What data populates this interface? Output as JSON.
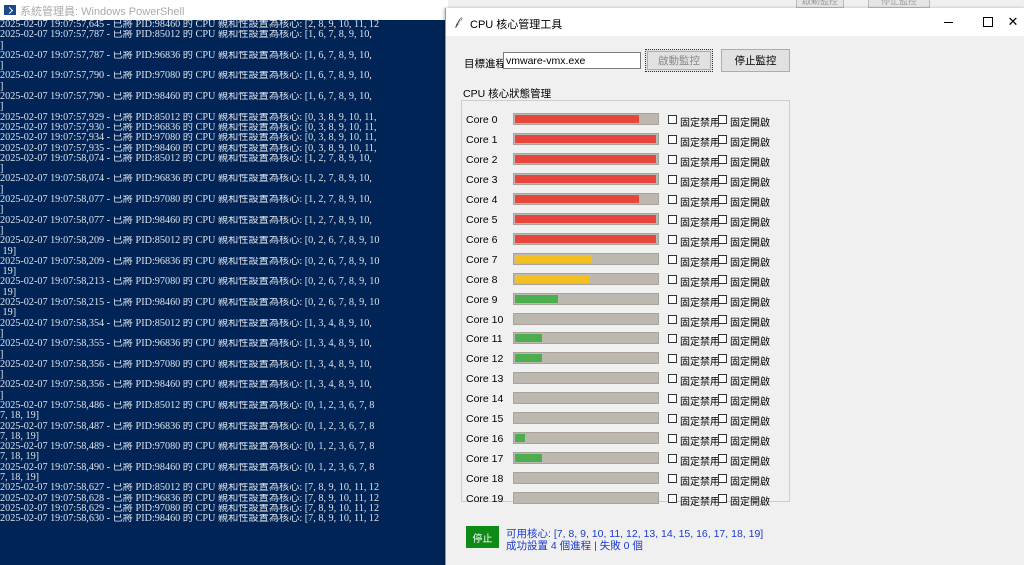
{
  "powershell": {
    "title": "系統管理員: Windows PowerShell",
    "lines": [
      "2025-02-07 19:07:57,645 - 已將 PID:98460 的 CPU 親和性設置為核心: [2, 8, 9, 10, 11, 12",
      "2025-02-07 19:07:57,787 - 已將 PID:85012 的 CPU 親和性設置為核心: [1, 6, 7, 8, 9, 10,",
      "]",
      "2025-02-07 19:07:57,787 - 已將 PID:96836 的 CPU 親和性設置為核心: [1, 6, 7, 8, 9, 10,",
      "]",
      "2025-02-07 19:07:57,790 - 已將 PID:97080 的 CPU 親和性設置為核心: [1, 6, 7, 8, 9, 10,",
      "]",
      "2025-02-07 19:07:57,790 - 已將 PID:98460 的 CPU 親和性設置為核心: [1, 6, 7, 8, 9, 10,",
      "]",
      "2025-02-07 19:07:57,929 - 已將 PID:85012 的 CPU 親和性設置為核心: [0, 3, 8, 9, 10, 11,",
      "2025-02-07 19:07:57,930 - 已將 PID:96836 的 CPU 親和性設置為核心: [0, 3, 8, 9, 10, 11,",
      "2025-02-07 19:07:57,934 - 已將 PID:97080 的 CPU 親和性設置為核心: [0, 3, 8, 9, 10, 11,",
      "2025-02-07 19:07:57,935 - 已將 PID:98460 的 CPU 親和性設置為核心: [0, 3, 8, 9, 10, 11,",
      "2025-02-07 19:07:58,074 - 已將 PID:85012 的 CPU 親和性設置為核心: [1, 2, 7, 8, 9, 10,",
      "]",
      "2025-02-07 19:07:58,074 - 已將 PID:96836 的 CPU 親和性設置為核心: [1, 2, 7, 8, 9, 10,",
      "]",
      "2025-02-07 19:07:58,077 - 已將 PID:97080 的 CPU 親和性設置為核心: [1, 2, 7, 8, 9, 10,",
      "]",
      "2025-02-07 19:07:58,077 - 已將 PID:98460 的 CPU 親和性設置為核心: [1, 2, 7, 8, 9, 10,",
      "]",
      "2025-02-07 19:07:58,209 - 已將 PID:85012 的 CPU 親和性設置為核心: [0, 2, 6, 7, 8, 9, 10",
      " 19]",
      "2025-02-07 19:07:58,209 - 已將 PID:96836 的 CPU 親和性設置為核心: [0, 2, 6, 7, 8, 9, 10",
      " 19]",
      "2025-02-07 19:07:58,213 - 已將 PID:97080 的 CPU 親和性設置為核心: [0, 2, 6, 7, 8, 9, 10",
      " 19]",
      "2025-02-07 19:07:58,215 - 已將 PID:98460 的 CPU 親和性設置為核心: [0, 2, 6, 7, 8, 9, 10",
      " 19]",
      "2025-02-07 19:07:58,354 - 已將 PID:85012 的 CPU 親和性設置為核心: [1, 3, 4, 8, 9, 10,",
      "]",
      "2025-02-07 19:07:58,355 - 已將 PID:96836 的 CPU 親和性設置為核心: [1, 3, 4, 8, 9, 10,",
      "]",
      "2025-02-07 19:07:58,356 - 已將 PID:97080 的 CPU 親和性設置為核心: [1, 3, 4, 8, 9, 10,",
      "]",
      "2025-02-07 19:07:58,356 - 已將 PID:98460 的 CPU 親和性設置為核心: [1, 3, 4, 8, 9, 10,",
      "]",
      "2025-02-07 19:07:58,486 - 已將 PID:85012 的 CPU 親和性設置為核心: [0, 1, 2, 3, 6, 7, 8",
      "7, 18, 19]",
      "2025-02-07 19:07:58,487 - 已將 PID:96836 的 CPU 親和性設置為核心: [0, 1, 2, 3, 6, 7, 8",
      "7, 18, 19]",
      "2025-02-07 19:07:58,489 - 已將 PID:97080 的 CPU 親和性設置為核心: [0, 1, 2, 3, 6, 7, 8",
      "7, 18, 19]",
      "2025-02-07 19:07:58,490 - 已將 PID:98460 的 CPU 親和性設置為核心: [0, 1, 2, 3, 6, 7, 8",
      "7, 18, 19]",
      "2025-02-07 19:07:58,627 - 已將 PID:85012 的 CPU 親和性設置為核心: [7, 8, 9, 10, 11, 12",
      "2025-02-07 19:07:58,628 - 已將 PID:96836 的 CPU 親和性設置為核心: [7, 8, 9, 10, 11, 12",
      "2025-02-07 19:07:58,629 - 已將 PID:97080 的 CPU 親和性設置為核心: [7, 8, 9, 10, 11, 12",
      "2025-02-07 19:07:58,630 - 已將 PID:98460 的 CPU 親和性設置為核心: [7, 8, 9, 10, 11, 12"
    ]
  },
  "background_buttons": [
    "啟動監控",
    "停止監控"
  ],
  "app": {
    "title": "CPU 核心管理工具",
    "target_label": "目標進程:",
    "target_value": "vmware-vmx.exe",
    "start_button": "啟動監控",
    "stop_button": "停止監控",
    "group_label": "CPU 核心狀態管理",
    "lock_disable_label": "固定禁用",
    "lock_enable_label": "固定開啟",
    "colors": {
      "high": "#e8453c",
      "medium": "#f4bf22",
      "low": "#4cae4f",
      "track": "#bcb8b0"
    },
    "cores": [
      {
        "label": "Core 0",
        "load": 0.87,
        "level": "high"
      },
      {
        "label": "Core 1",
        "load": 0.99,
        "level": "high"
      },
      {
        "label": "Core 2",
        "load": 0.99,
        "level": "high"
      },
      {
        "label": "Core 3",
        "load": 0.99,
        "level": "high"
      },
      {
        "label": "Core 4",
        "load": 0.87,
        "level": "high"
      },
      {
        "label": "Core 5",
        "load": 0.99,
        "level": "high"
      },
      {
        "label": "Core 6",
        "load": 0.99,
        "level": "high"
      },
      {
        "label": "Core 7",
        "load": 0.54,
        "level": "medium"
      },
      {
        "label": "Core 8",
        "load": 0.53,
        "level": "medium"
      },
      {
        "label": "Core 9",
        "load": 0.3,
        "level": "low"
      },
      {
        "label": "Core 10",
        "load": 0.0,
        "level": "low"
      },
      {
        "label": "Core 11",
        "load": 0.19,
        "level": "low"
      },
      {
        "label": "Core 12",
        "load": 0.19,
        "level": "low"
      },
      {
        "label": "Core 13",
        "load": 0.0,
        "level": "low"
      },
      {
        "label": "Core 14",
        "load": 0.0,
        "level": "low"
      },
      {
        "label": "Core 15",
        "load": 0.0,
        "level": "low"
      },
      {
        "label": "Core 16",
        "load": 0.07,
        "level": "low"
      },
      {
        "label": "Core 17",
        "load": 0.19,
        "level": "low"
      },
      {
        "label": "Core 18",
        "load": 0.0,
        "level": "low"
      },
      {
        "label": "Core 19",
        "load": 0.0,
        "level": "low"
      }
    ],
    "status_button": "停止",
    "status_button_color": "#0e8a16",
    "available_cores": "可用核心: [7, 8, 9, 10, 11, 12, 13, 14, 15, 16, 17, 18, 19]",
    "result_summary": "成功設置 4 個進程 | 失敗 0 個"
  }
}
